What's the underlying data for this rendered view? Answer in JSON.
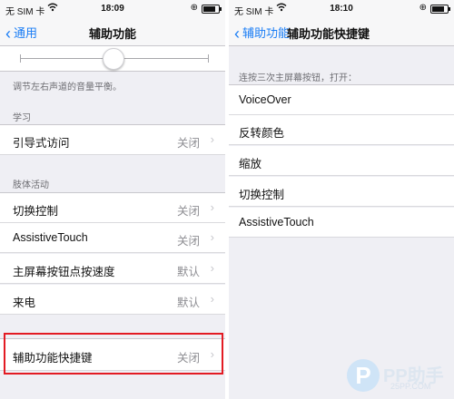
{
  "left": {
    "status": {
      "carrier": "无 SIM 卡",
      "time": "18:09"
    },
    "nav": {
      "back": "通用",
      "title": "辅助功能"
    },
    "balance_note": "调节左右声道的音量平衡。",
    "sections": {
      "learning": {
        "header": "学习",
        "rows": [
          {
            "label": "引导式访问",
            "value": "关闭"
          }
        ]
      },
      "physical": {
        "header": "肢体活动",
        "rows": [
          {
            "label": "切换控制",
            "value": "关闭"
          },
          {
            "label": "AssistiveTouch",
            "value": "关闭"
          },
          {
            "label": "主屏幕按钮点按速度",
            "value": "默认"
          },
          {
            "label": "来电",
            "value": "默认"
          }
        ]
      },
      "shortcut": {
        "rows": [
          {
            "label": "辅助功能快捷键",
            "value": "关闭"
          }
        ]
      }
    }
  },
  "right": {
    "status": {
      "carrier": "无 SIM 卡",
      "time": "18:10"
    },
    "nav": {
      "back": "辅助功能",
      "title": "辅助功能快捷键"
    },
    "section_header": "连按三次主屏幕按钮，打开：",
    "options": [
      "VoiceOver",
      "反转颜色",
      "缩放",
      "切换控制",
      "AssistiveTouch"
    ]
  },
  "watermark": {
    "brand": "PP助手",
    "site": "25PP.COM"
  },
  "colors": {
    "accent": "#1a7df5",
    "highlight": "#e31b23"
  },
  "icons": {
    "back": "chevron-left-icon",
    "row": "chevron-right-icon",
    "wifi": "wifi-icon",
    "lock": "rotation-lock-icon",
    "battery": "battery-icon"
  }
}
